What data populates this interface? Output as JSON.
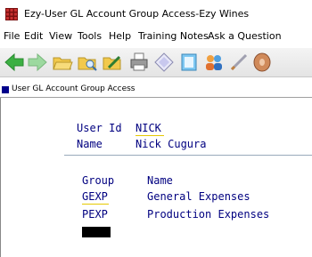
{
  "window": {
    "title": "Ezy-User GL Account Group Access-Ezy Wines"
  },
  "menu": [
    "File",
    "Edit",
    "View",
    "Tools",
    "Help",
    "Training Notes",
    "Ask a Question"
  ],
  "toolbar": {
    "icons": [
      "back-arrow-icon",
      "forward-arrow-icon",
      "folder-open-icon",
      "folder-search-icon",
      "folder-edit-icon",
      "print-icon",
      "diamond-icon",
      "notes-icon",
      "users-icon",
      "pen-icon",
      "disc-icon"
    ]
  },
  "document": {
    "tab_label": "User GL Account Group Access"
  },
  "form": {
    "user_id_label": "User Id",
    "user_id_value": "NICK",
    "name_label": "Name",
    "name_value": "Nick Cugura"
  },
  "grid": {
    "headers": {
      "group": "Group",
      "name": "Name"
    },
    "rows": [
      {
        "group": "GEXP",
        "name": "General Expenses"
      },
      {
        "group": "PEXP",
        "name": "Production Expenses"
      }
    ]
  },
  "colors": {
    "label_text": "#000080",
    "accent_underline": "#e6c800",
    "cursor": "#000000"
  }
}
